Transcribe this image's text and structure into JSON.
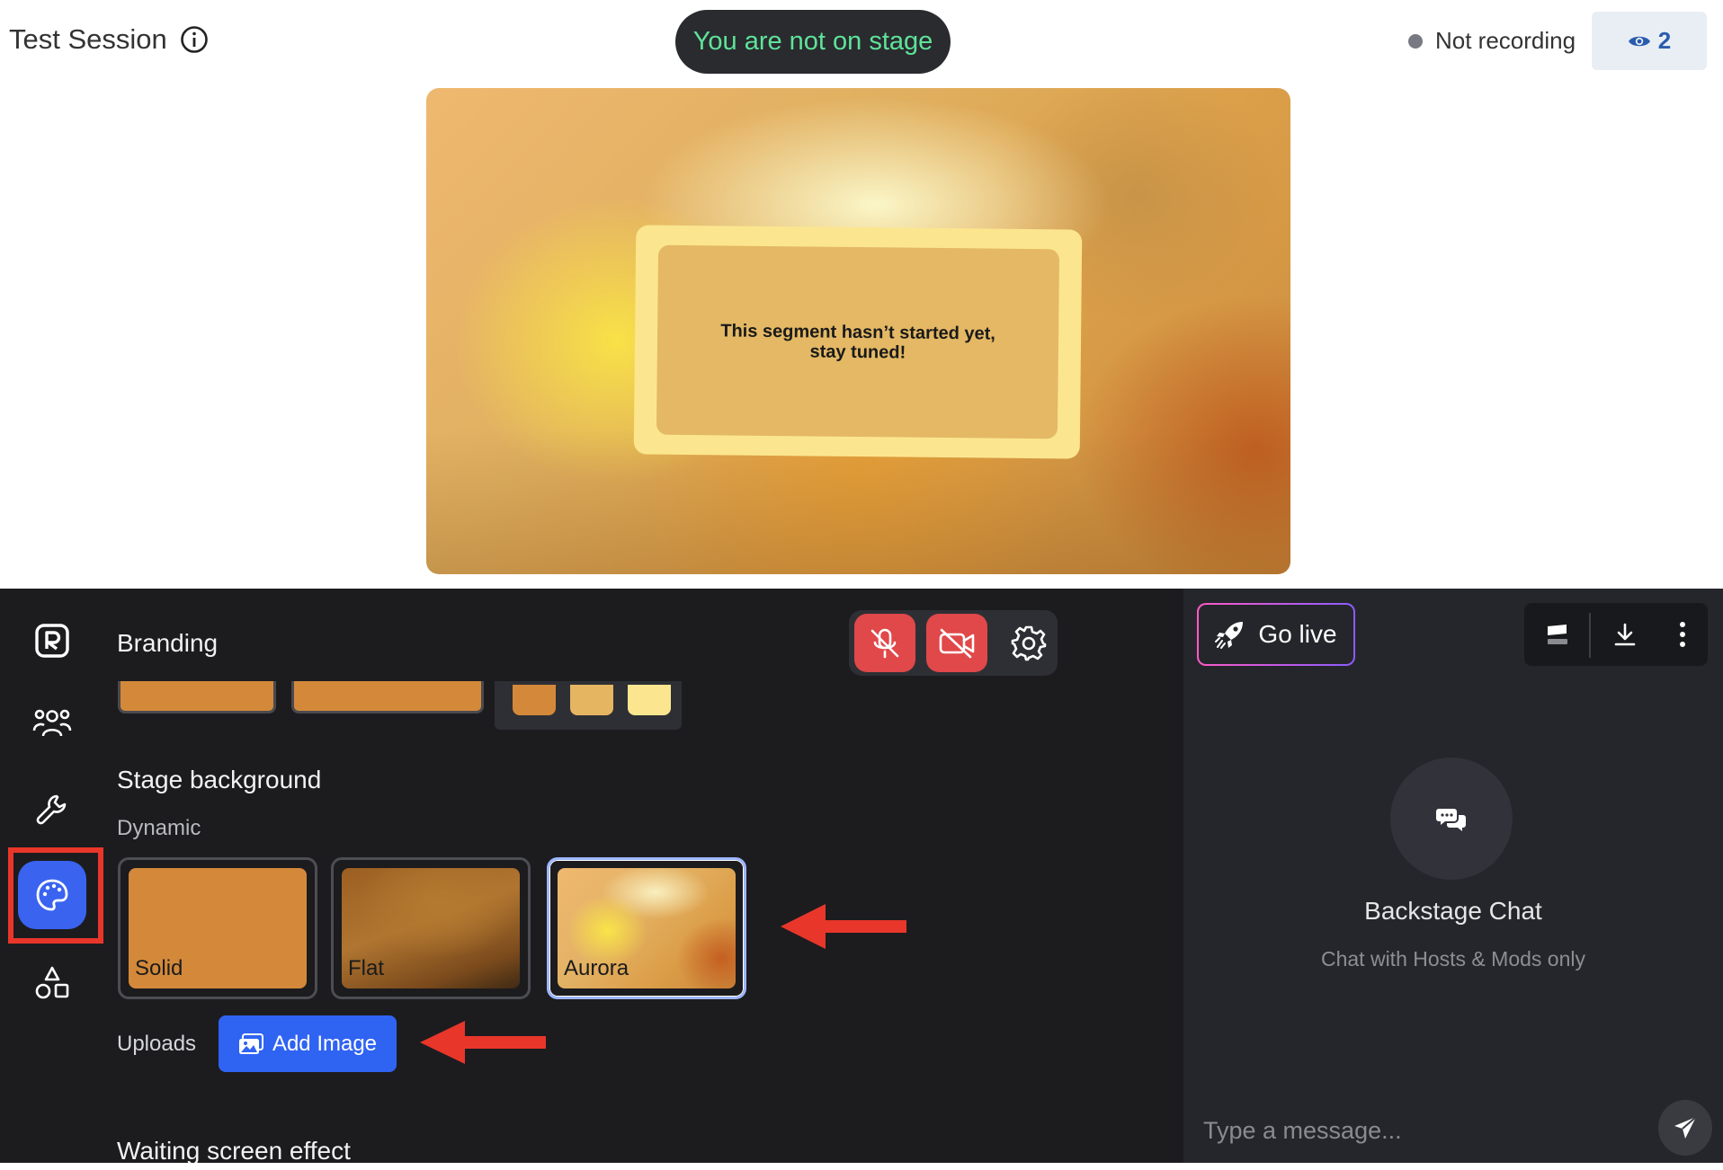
{
  "header": {
    "session_title": "Test Session",
    "stage_status": "You are not on stage",
    "recording_status": "Not recording",
    "viewer_count": "2"
  },
  "stage": {
    "segment_message": "This segment hasn’t started yet, stay tuned!"
  },
  "sidebar": {
    "items": [
      {
        "icon": "logo-r-icon"
      },
      {
        "icon": "people-icon"
      },
      {
        "icon": "wrench-icon"
      },
      {
        "icon": "palette-icon",
        "active": true
      },
      {
        "icon": "shapes-icon"
      }
    ]
  },
  "branding": {
    "title": "Branding",
    "palette_colors": [
      "#d4893a",
      "#e6b562",
      "#fbe68f"
    ],
    "stage_background_title": "Stage background",
    "dynamic_label": "Dynamic",
    "tiles": [
      {
        "label": "Solid",
        "selected": false
      },
      {
        "label": "Flat",
        "selected": false
      },
      {
        "label": "Aurora",
        "selected": true
      }
    ],
    "uploads_label": "Uploads",
    "add_image_label": "Add Image",
    "waiting_screen_title": "Waiting screen effect"
  },
  "media_controls": {
    "mic": "muted",
    "camera": "off",
    "settings_icon": "gear-icon"
  },
  "chat": {
    "go_live_label": "Go live",
    "title": "Backstage Chat",
    "subtitle": "Chat with Hosts & Mods only",
    "input_placeholder": "Type a message..."
  },
  "colors": {
    "accent_blue": "#3a63f0",
    "danger_red": "#e0484a",
    "stage_pill_text": "#5ee39a",
    "annotation_red": "#e8362a"
  }
}
